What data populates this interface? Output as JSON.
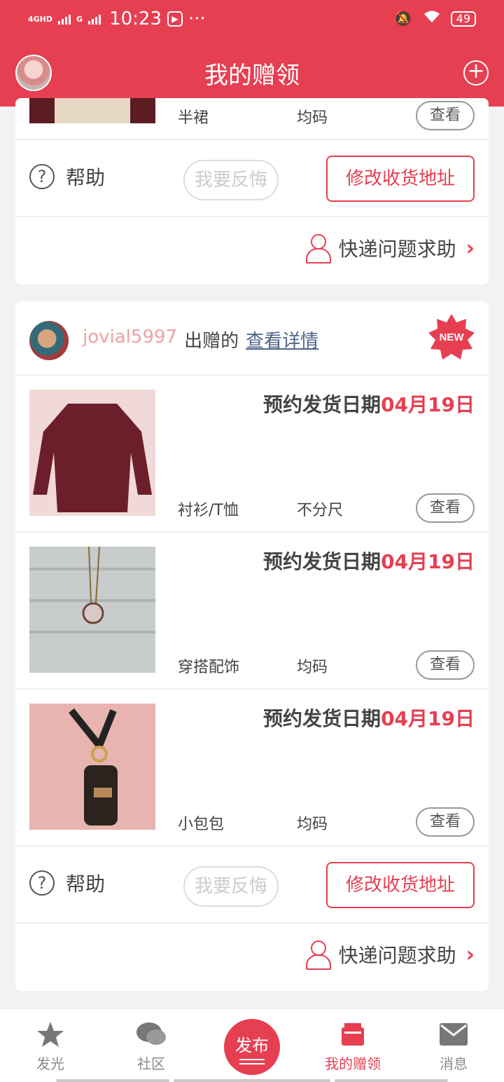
{
  "status_bar": {
    "network": "4GHD",
    "network2": "G",
    "time": "10:23",
    "more": "···",
    "battery": "49"
  },
  "header": {
    "title": "我的赠领",
    "add_icon": "plus-circle-icon"
  },
  "card1": {
    "item": {
      "category": "半裙",
      "size": "均码",
      "view_label": "查看"
    },
    "actions": {
      "help_label": "帮助",
      "regret_label": "我要反悔",
      "address_label": "修改收货地址"
    },
    "express_label": "快递问题求助"
  },
  "card2": {
    "giver": {
      "name": "jovial5997",
      "action": "出赠的",
      "detail_link": "查看详情",
      "badge": "NEW"
    },
    "items": [
      {
        "ship_prefix": "预约发货日期",
        "ship_date": "04月19日",
        "category": "衬衫/T恤",
        "size": "不分尺",
        "view_label": "查看"
      },
      {
        "ship_prefix": "预约发货日期",
        "ship_date": "04月19日",
        "category": "穿搭配饰",
        "size": "均码",
        "view_label": "查看"
      },
      {
        "ship_prefix": "预约发货日期",
        "ship_date": "04月19日",
        "category": "小包包",
        "size": "均码",
        "view_label": "查看"
      }
    ],
    "actions": {
      "help_label": "帮助",
      "regret_label": "我要反悔",
      "address_label": "修改收货地址"
    },
    "express_label": "快递问题求助"
  },
  "nav": {
    "items": [
      {
        "label": "发光",
        "icon": "star-icon"
      },
      {
        "label": "社区",
        "icon": "chat-bubbles-icon"
      },
      {
        "label": "发布",
        "icon": "publish-button"
      },
      {
        "label": "我的赠领",
        "icon": "gift-box-icon"
      },
      {
        "label": "消息",
        "icon": "mail-icon"
      }
    ]
  },
  "colors": {
    "brand": "#e63f52",
    "link": "#51648a",
    "giver_name": "#eba3a3"
  }
}
